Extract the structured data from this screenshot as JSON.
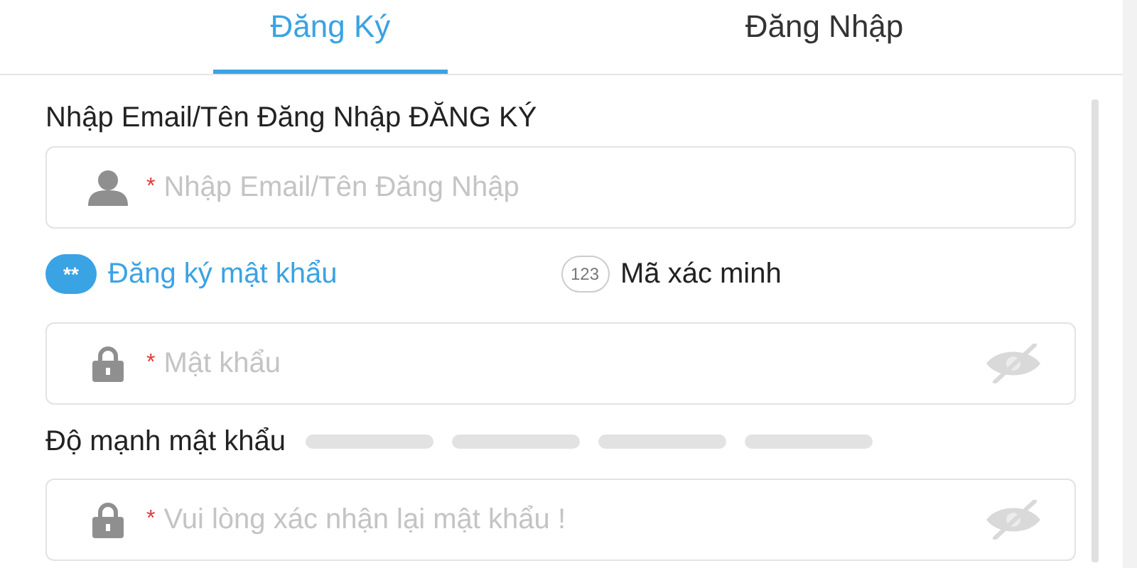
{
  "tabs": [
    {
      "label": "Đăng Ký",
      "selected": true
    },
    {
      "label": "Đăng Nhập",
      "selected": false
    }
  ],
  "account_label": "Nhập Email/Tên Đăng Nhập ĐĂNG KÝ",
  "account_field": {
    "kind": "email",
    "required_mark": "*",
    "placeholder": "Nhập Email/Tên Đăng Nhập"
  },
  "methods": [
    {
      "icon_text": "**",
      "label": "Đăng ký mật khẩu",
      "selected": true
    },
    {
      "icon_text": "123",
      "label": "Mã xác minh",
      "selected": false
    }
  ],
  "password_field": {
    "kind": "password",
    "required_mark": "*",
    "placeholder": "Mật khẩu"
  },
  "strength": {
    "label": "Độ mạnh mật khẩu",
    "segments": [
      {
        "filled": false
      },
      {
        "filled": false
      },
      {
        "filled": false
      },
      {
        "filled": false
      }
    ]
  },
  "confirm_field": {
    "kind": "password",
    "required_mark": "*",
    "placeholder": "Vui lòng xác nhận lại mật khẩu !"
  }
}
